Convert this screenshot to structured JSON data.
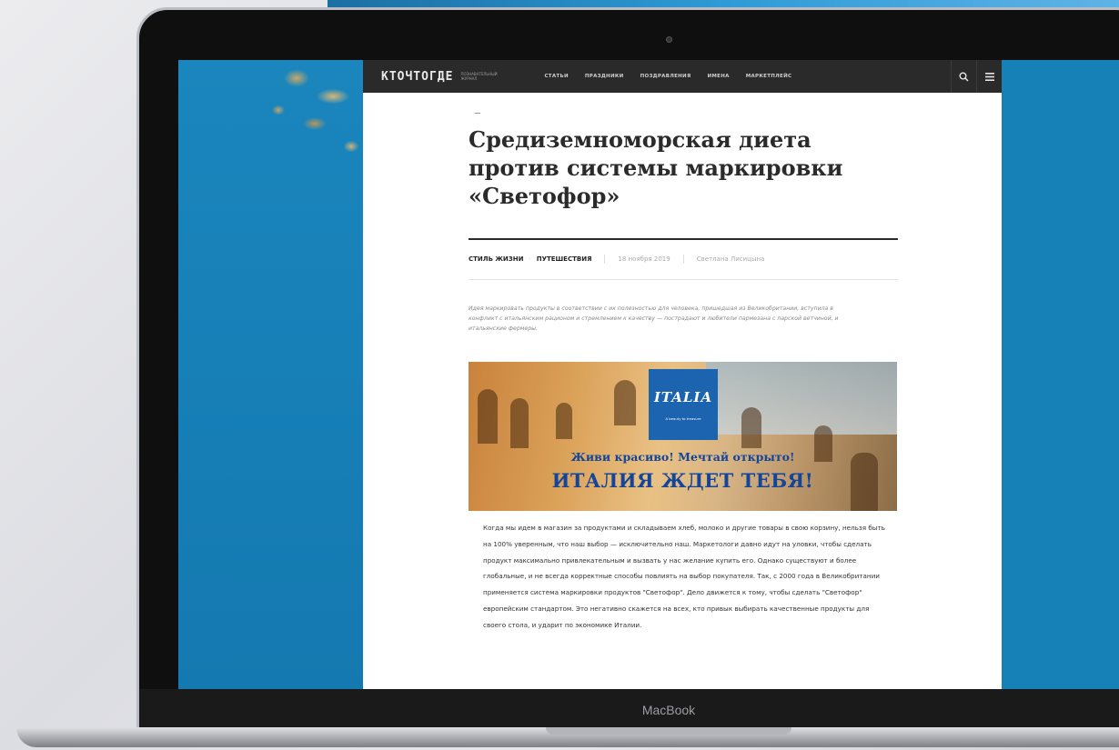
{
  "site": {
    "logo": "КТОЧТОГДЕ",
    "logo_sub": "ПОЗНАВАТЕЛЬНЫЙ ЖУРНАЛ",
    "nav": [
      "СТАТЬИ",
      "ПРАЗДНИКИ",
      "ПОЗДРАВЛЕНИЯ",
      "ИМЕНА",
      "МАРКЕТПЛЕЙС"
    ],
    "icons": [
      "search-icon",
      "menu-icon"
    ]
  },
  "article": {
    "title": "Средиземноморская диета против системы маркировки «Светофор»",
    "categories": [
      "СТИЛЬ ЖИЗНИ",
      "ПУТЕШЕСТВИЯ"
    ],
    "date": "18 ноября 2019",
    "author": "Светлана Лисицына",
    "lead": "Идея маркировать продукты в соответствии с их полезностью для человека, пришедшая из Великобритании, вступила в конфликт с итальянским рационом и стремлением к качеству — пострадают и любители пармезана с парской ветчиной, и итальянские фермеры.",
    "banner": {
      "logo": "ITALIA",
      "tagline": "A beauty to treasure",
      "line1": "Живи красиво! Мечтай открыто!",
      "line2": "ИТАЛИЯ ЖДЕТ ТЕБЯ!"
    },
    "body": "Когда мы идем в магазин за продуктами и складываем хлеб, молоко и другие товары в свою корзину, нельзя быть на 100% уверенным, что наш выбор — исключительно наш. Маркетологи давно идут на уловки, чтобы сделать продукт максимально привлекательным и вызвать у нас желание купить его. Однако существуют и более глобальные, и не всегда корректные способы повлиять на выбор покупателя. Так, с 2000 года в Великобритании применяется система маркировки продуктов \"Светофор\". Дело движется к тому, чтобы сделать \"Светофор\" европейским стандартом. Это негативно скажется на всех, кто привык выбирать качественные продукты для своего стола, и ударит по экономике Италии."
  },
  "device": {
    "label": "MacBook"
  },
  "colors": {
    "screen_bg": "#1681b6",
    "header_bg": "#2a2a2a",
    "banner_text": "#13469a",
    "italia_box": "#1d64b0"
  }
}
